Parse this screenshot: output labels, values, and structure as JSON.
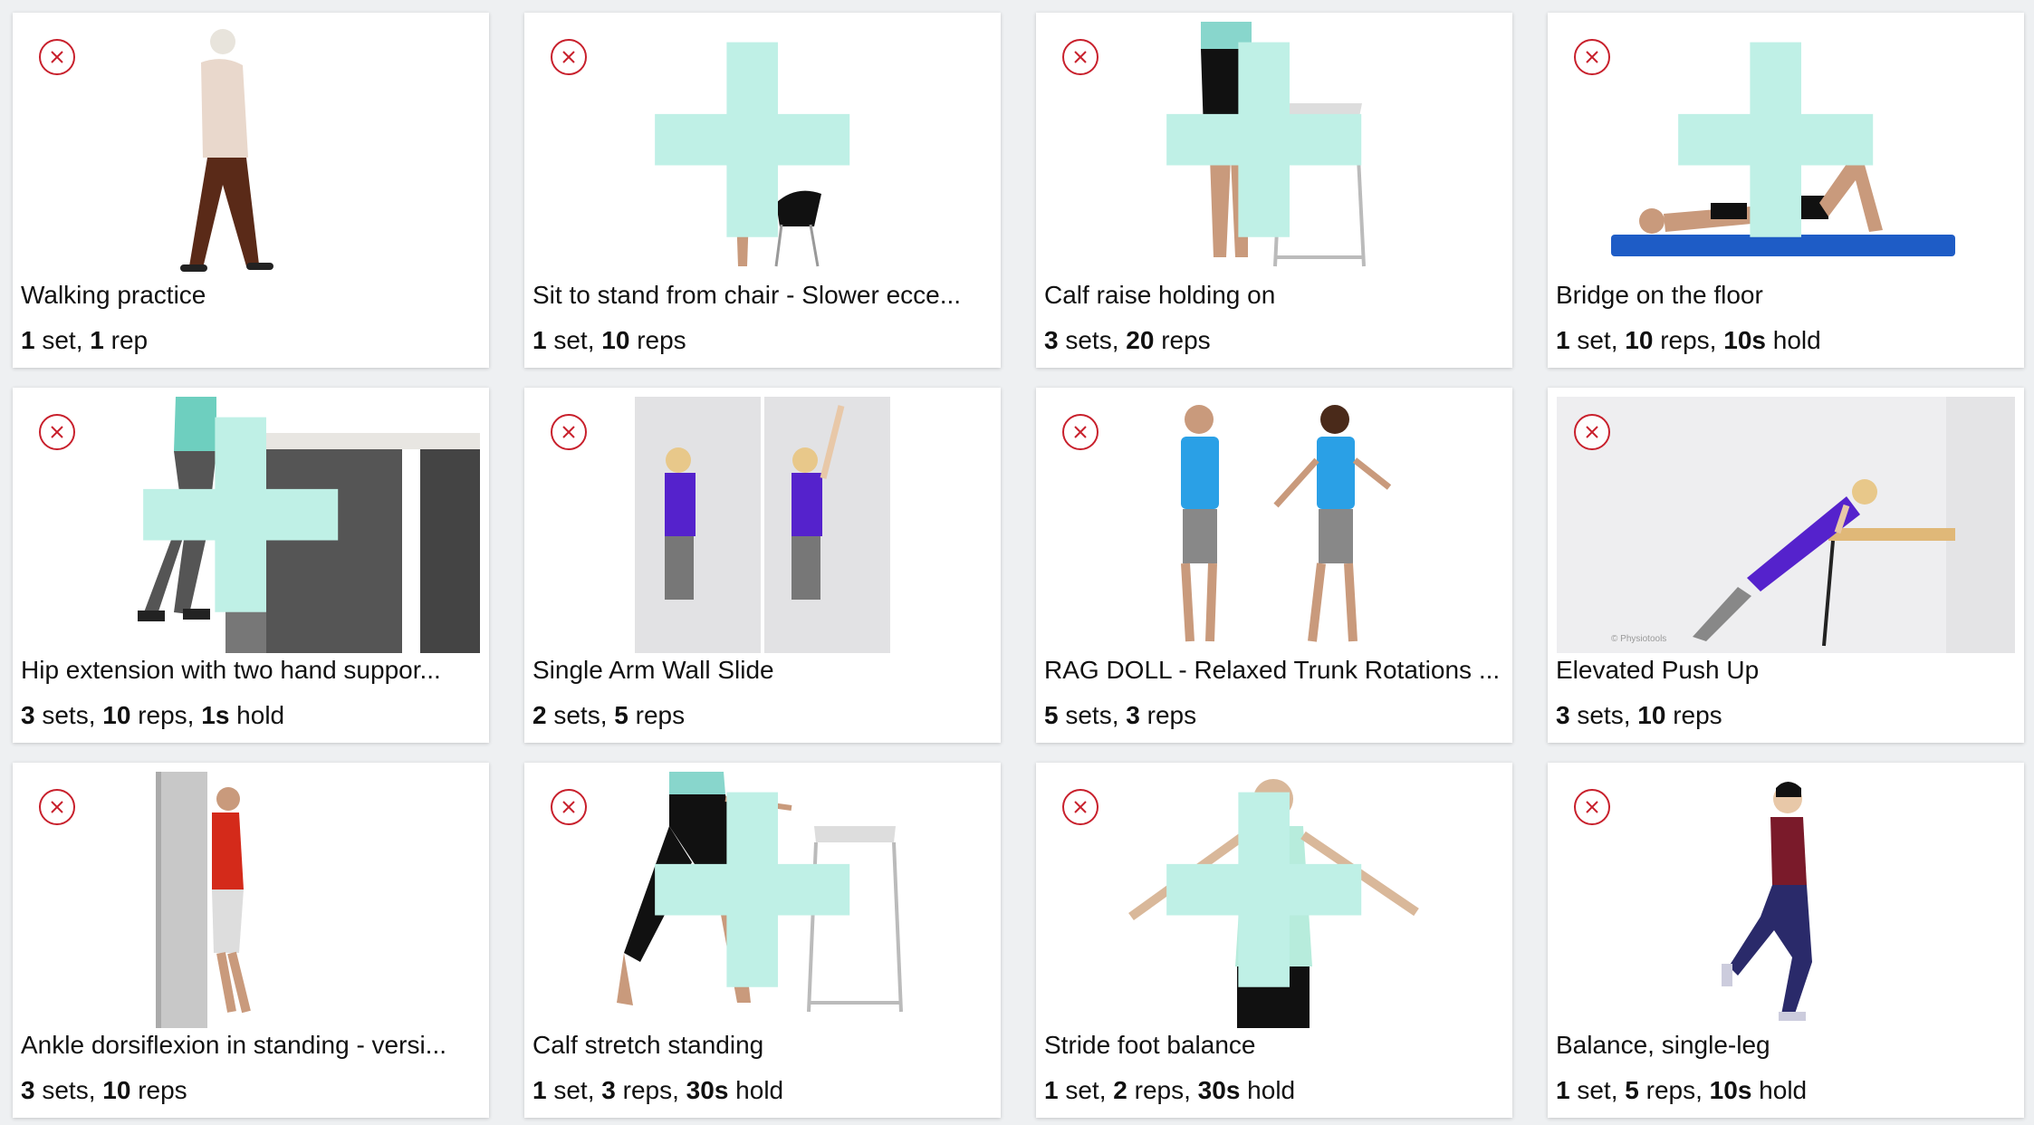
{
  "cards": [
    {
      "title": "Walking practice",
      "stats": [
        {
          "num": "1",
          "unit": " set, "
        },
        {
          "num": "1",
          "unit": " rep"
        }
      ]
    },
    {
      "title": "Sit to stand from chair - Slower ecce...",
      "stats": [
        {
          "num": "1",
          "unit": " set, "
        },
        {
          "num": "10",
          "unit": " reps"
        }
      ]
    },
    {
      "title": "Calf raise holding on",
      "stats": [
        {
          "num": "3",
          "unit": " sets, "
        },
        {
          "num": "20",
          "unit": " reps"
        }
      ]
    },
    {
      "title": "Bridge on the floor",
      "stats": [
        {
          "num": "1",
          "unit": " set, "
        },
        {
          "num": "10",
          "unit": " reps, "
        },
        {
          "num": "10s",
          "unit": " hold"
        }
      ]
    },
    {
      "title": "Hip extension with two hand suppor...",
      "stats": [
        {
          "num": "3",
          "unit": " sets, "
        },
        {
          "num": "10",
          "unit": " reps, "
        },
        {
          "num": "1s",
          "unit": " hold"
        }
      ]
    },
    {
      "title": "Single Arm Wall Slide",
      "stats": [
        {
          "num": "2",
          "unit": " sets, "
        },
        {
          "num": "5",
          "unit": " reps"
        }
      ]
    },
    {
      "title": "RAG DOLL - Relaxed Trunk Rotations ...",
      "stats": [
        {
          "num": "5",
          "unit": " sets, "
        },
        {
          "num": "3",
          "unit": " reps"
        }
      ]
    },
    {
      "title": "Elevated Push Up",
      "stats": [
        {
          "num": "3",
          "unit": " sets, "
        },
        {
          "num": "10",
          "unit": " reps"
        }
      ],
      "watermark": "© Physiotools"
    },
    {
      "title": "Ankle dorsiflexion in standing - versi...",
      "stats": [
        {
          "num": "3",
          "unit": " sets, "
        },
        {
          "num": "10",
          "unit": " reps"
        }
      ]
    },
    {
      "title": "Calf stretch standing",
      "stats": [
        {
          "num": "1",
          "unit": " set, "
        },
        {
          "num": "3",
          "unit": " reps, "
        },
        {
          "num": "30s",
          "unit": " hold"
        }
      ]
    },
    {
      "title": "Stride foot balance",
      "stats": [
        {
          "num": "1",
          "unit": " set, "
        },
        {
          "num": "2",
          "unit": " reps, "
        },
        {
          "num": "30s",
          "unit": " hold"
        }
      ]
    },
    {
      "title": "Balance, single-leg",
      "stats": [
        {
          "num": "1",
          "unit": " set, "
        },
        {
          "num": "5",
          "unit": " reps, "
        },
        {
          "num": "10s",
          "unit": " hold"
        }
      ]
    }
  ],
  "colors": {
    "remove": "#c8202c",
    "plus": "#bff0e6"
  },
  "icons": {
    "remove": "close-circle-icon",
    "plus": "plus-arrow-icon"
  }
}
